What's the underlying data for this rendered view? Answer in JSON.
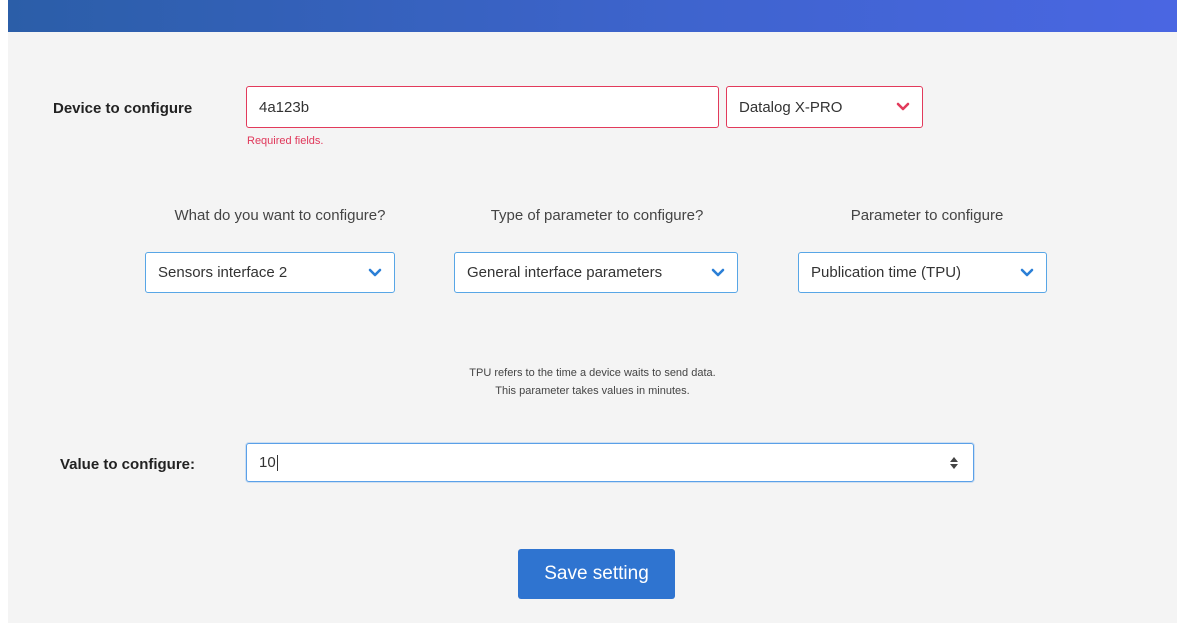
{
  "device": {
    "label": "Device to configure",
    "id_value": "4a123b",
    "model_selected": "Datalog X-PRO",
    "error_text": "Required fields."
  },
  "config": {
    "what_label": "What do you want to configure?",
    "what_selected": "Sensors interface 2",
    "type_label": "Type of parameter to configure?",
    "type_selected": "General interface parameters",
    "param_label": "Parameter to configure",
    "param_selected": "Publication time (TPU)"
  },
  "hint": {
    "line1": "TPU refers to the time a device waits to send data.",
    "line2": "This parameter takes values in minutes."
  },
  "value": {
    "label": "Value to configure:",
    "current": "10"
  },
  "actions": {
    "save_label": "Save setting"
  },
  "colors": {
    "top_bar": "#3f64cf",
    "error": "#e23a5b",
    "select_border": "#58a6e6",
    "button": "#2f74d0"
  }
}
